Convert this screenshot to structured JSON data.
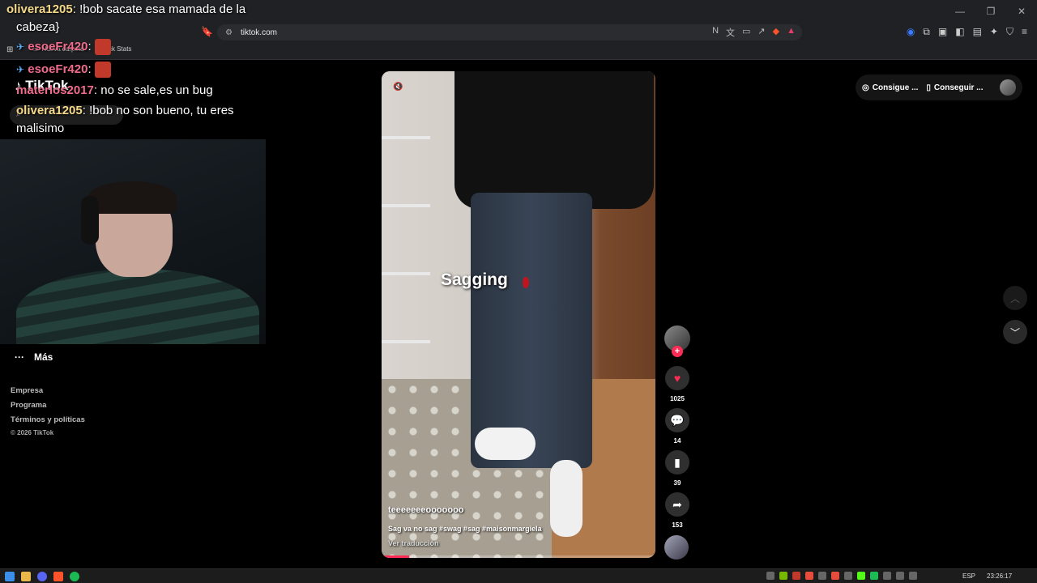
{
  "browser": {
    "url": "tiktok.com",
    "bookmarks": [
      "Nueva carpeta",
      "Kick Stats"
    ]
  },
  "sidebar": {
    "logo": "TikTok",
    "more_label": "Más",
    "footer_links": [
      "Empresa",
      "Programa",
      "Términos y políticas"
    ],
    "copyright": "© 2026 TikTok"
  },
  "chat": [
    {
      "user": "olivera1205",
      "text": ": !bob sacate esa mamada de la",
      "user_color": "#f5d98a"
    },
    {
      "user": "",
      "text": "cabeza}",
      "user_color": "#ffffff"
    },
    {
      "user": "esoeFr420",
      "text": ":",
      "user_color": "#f06b8c"
    },
    {
      "user": "esoeFr420",
      "text": ":",
      "user_color": "#f06b8c"
    },
    {
      "user": "materlos2017",
      "text": ": no se sale,es un bug",
      "user_color": "#f06b8c"
    },
    {
      "user": "olivera1205",
      "text": ": !bob no son bueno, tu eres",
      "user_color": "#f5d98a"
    },
    {
      "user": "",
      "text": "malisimo",
      "user_color": "#ffffff"
    }
  ],
  "video": {
    "overlay_text": "Sagging",
    "username": "teeeeeeeooooooo",
    "description": "Sag va no sag #swag #sag #maisonmargiela",
    "translate_label": "Ver traducción",
    "progress": 0.1
  },
  "actions": {
    "likes": "1025",
    "comments": "14",
    "saves": "39",
    "shares": "153"
  },
  "top_right": {
    "coins_label": "Consigue ...",
    "app_label": "Conseguir ..."
  },
  "taskbar": {
    "lang": "ESP",
    "time": "23:26:17"
  },
  "colors": {
    "accent": "#fe2c55",
    "background": "#000000"
  }
}
